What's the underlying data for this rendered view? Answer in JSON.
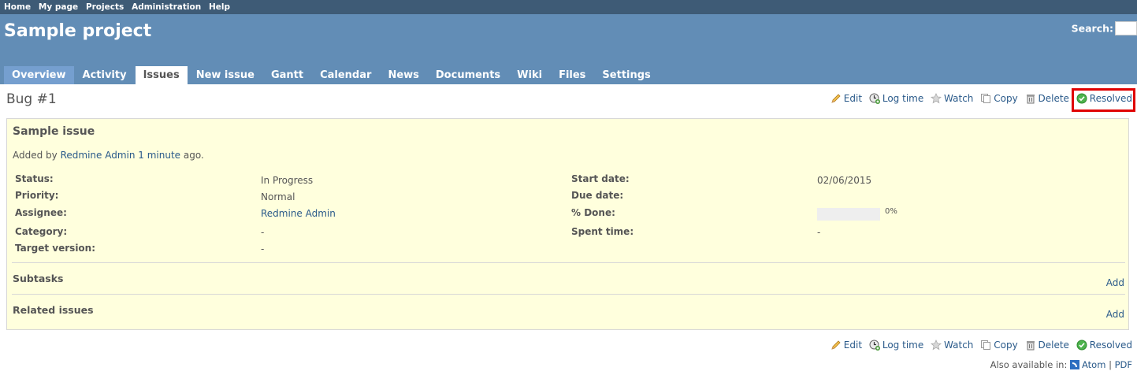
{
  "top_menu": {
    "items": [
      "Home",
      "My page",
      "Projects",
      "Administration",
      "Help"
    ]
  },
  "header": {
    "project_title": "Sample project",
    "search_label": "Search:",
    "search_value": ""
  },
  "tabs": [
    "Overview",
    "Activity",
    "Issues",
    "New issue",
    "Gantt",
    "Calendar",
    "News",
    "Documents",
    "Wiki",
    "Files",
    "Settings"
  ],
  "selected_tab": "Issues",
  "issue": {
    "heading": "Bug #1",
    "subject": "Sample issue",
    "author_prefix": "Added by",
    "author": "Redmine Admin",
    "age": "1 minute",
    "age_suffix": "ago.",
    "attributes_left": [
      {
        "label": "Status:",
        "value": "In Progress",
        "link": false
      },
      {
        "label": "Priority:",
        "value": "Normal",
        "link": false
      },
      {
        "label": "Assignee:",
        "value": "Redmine Admin",
        "link": true
      },
      {
        "label": "Category:",
        "value": "-",
        "link": false
      },
      {
        "label": "Target version:",
        "value": "-",
        "link": false
      }
    ],
    "attributes_right": [
      {
        "label": "Start date:",
        "value": "02/06/2015"
      },
      {
        "label": "Due date:",
        "value": ""
      },
      {
        "label": "% Done:",
        "value": "0%",
        "progress": 0
      },
      {
        "label": "Spent time:",
        "value": "-"
      }
    ],
    "subtasks_title": "Subtasks",
    "related_title": "Related issues",
    "add_label": "Add"
  },
  "actions_top": {
    "edit": "Edit",
    "log_time": "Log time",
    "watch": "Watch",
    "copy": "Copy",
    "delete": "Delete",
    "resolved": "Resolved"
  },
  "actions_bottom": {
    "edit": "Edit",
    "log_time": "Log time",
    "watch": "Watch",
    "copy": "Copy",
    "delete": "Delete",
    "resolved": "Resolved"
  },
  "other_formats": {
    "prefix": "Also available in:",
    "atom": "Atom",
    "separator": "|",
    "pdf": "PDF"
  },
  "colors": {
    "top_menu_bg": "#3e5b76",
    "header_bg": "#628db6",
    "issue_bg": "#ffffdd",
    "highlight": "#e00000",
    "link": "#2a5a8a"
  }
}
